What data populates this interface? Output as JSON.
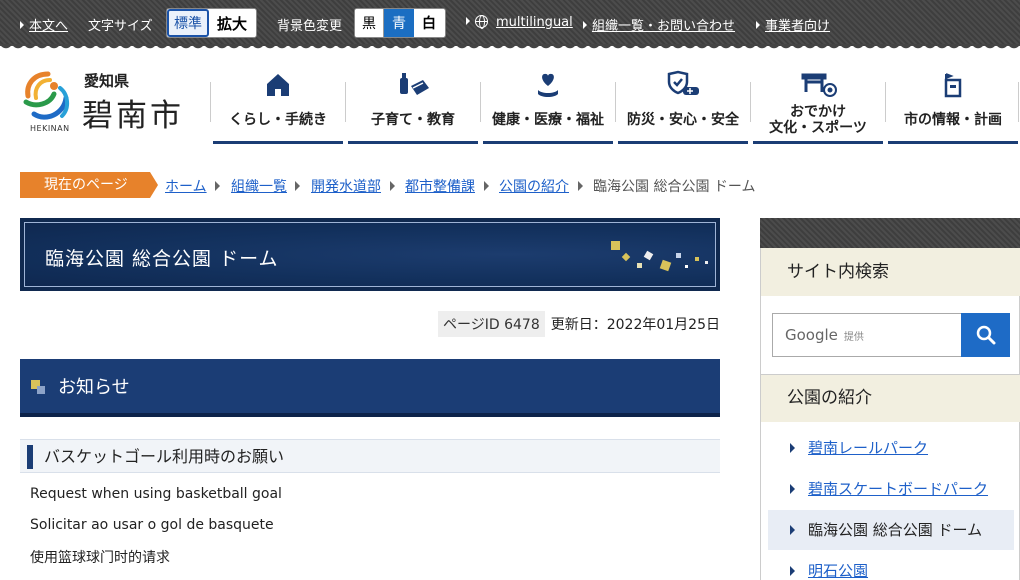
{
  "topbar": {
    "skip_link": "本文へ",
    "font_size_label": "文字サイズ",
    "font_standard": "標準",
    "font_large": "拡大",
    "bg_color_label": "背景色変更",
    "bg_black": "黒",
    "bg_blue": "青",
    "bg_white": "白",
    "multilingual": "multilingual",
    "org_contact": "組織一覧・お問い合わせ",
    "business": "事業者向け"
  },
  "logo": {
    "prefecture": "愛知県",
    "city": "碧南市",
    "romaji": "HEKINAN"
  },
  "nav": [
    {
      "label": "くらし・手続き",
      "icon": "house-icon"
    },
    {
      "label": "子育て・教育",
      "icon": "bottle-book-icon"
    },
    {
      "label": "健康・医療・福祉",
      "icon": "heart-hand-icon"
    },
    {
      "label": "防災・安心・安全",
      "icon": "shield-car-icon"
    },
    {
      "label_line1": "おでかけ",
      "label_line2": "文化・スポーツ",
      "icon": "gate-ball-icon"
    },
    {
      "label": "市の情報・計画",
      "icon": "city-hall-icon"
    }
  ],
  "breadcrumb": {
    "label": "現在のページ",
    "items": [
      "ホーム",
      "組織一覧",
      "開発水道部",
      "都市整備課",
      "公園の紹介"
    ],
    "current": "臨海公園 総合公園 ドーム"
  },
  "page": {
    "title": "臨海公園 総合公園 ドーム",
    "page_id_label": "ページID",
    "page_id": "6478",
    "updated": "更新日：2022年01月25日"
  },
  "content": {
    "section_heading": "お知らせ",
    "sub_heading": "バスケットゴール利用時のお願い",
    "lines": [
      "Request when using basketball goal",
      "Solicitar ao usar o gol de basquete",
      "使用篮球球门时的请求"
    ]
  },
  "sidebar": {
    "search_heading": "サイト内検索",
    "search_brand": "Google",
    "search_provided": "提供",
    "menu_heading": "公園の紹介",
    "menu_items": [
      "碧南レールパーク",
      "碧南スケートボードパーク",
      "臨海公園 総合公園 ドーム",
      "明石公園"
    ],
    "current_index": 2
  },
  "colors": {
    "navy": "#1b3d75",
    "accent_orange": "#e7822b",
    "link_blue": "#1e60c9",
    "search_blue": "#1e6bc6"
  }
}
